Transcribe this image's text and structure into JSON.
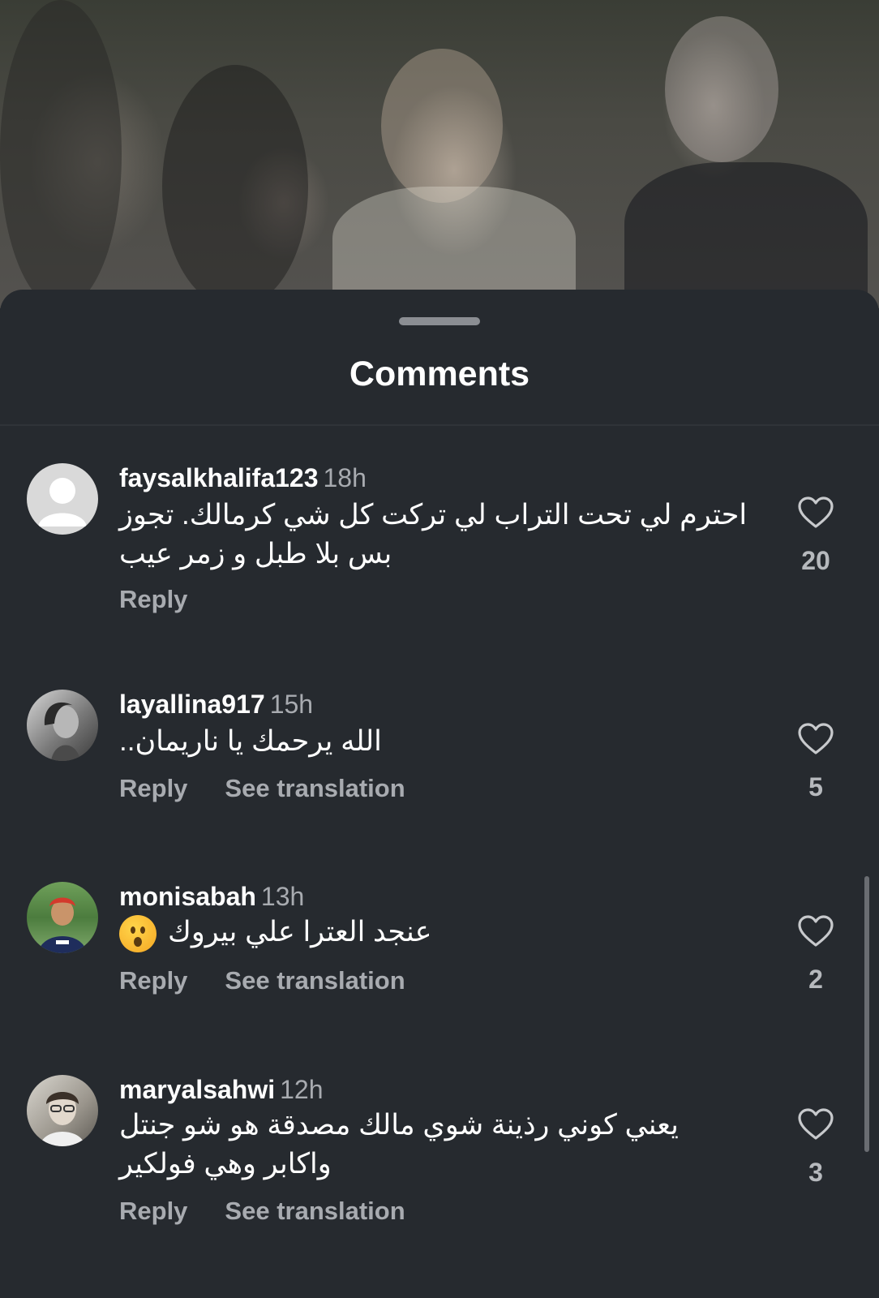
{
  "sheet": {
    "title": "Comments"
  },
  "comments": [
    {
      "username": "faysalkhalifa123",
      "time": "18h",
      "text": "احترم لي تحت التراب لي تركت كل شي كرمالك. تجوز بس بلا طبل و زمر عيب",
      "reply": "Reply",
      "see_translation": "",
      "likes": "20",
      "avatar": "default-avatar"
    },
    {
      "username": "layallina917",
      "time": "15h",
      "text": "الله يرحمك يا ناريمان..",
      "reply": "Reply",
      "see_translation": "See translation",
      "likes": "5",
      "avatar": "photo-avatar"
    },
    {
      "username": "monisabah",
      "time": "13h",
      "text": "عنجد العترا علي بيروك",
      "reply": "Reply",
      "see_translation": "See translation",
      "likes": "2",
      "avatar": "photo-avatar",
      "emoji": "surprised-face-emoji"
    },
    {
      "username": "maryalsahwi",
      "time": "12h",
      "text": "يعني كوني رذينة شوي مالك مصدقة هو شو جنتل واكابر وهي فولكير",
      "reply": "Reply",
      "see_translation": "See translation",
      "likes": "3",
      "avatar": "photo-avatar"
    }
  ]
}
